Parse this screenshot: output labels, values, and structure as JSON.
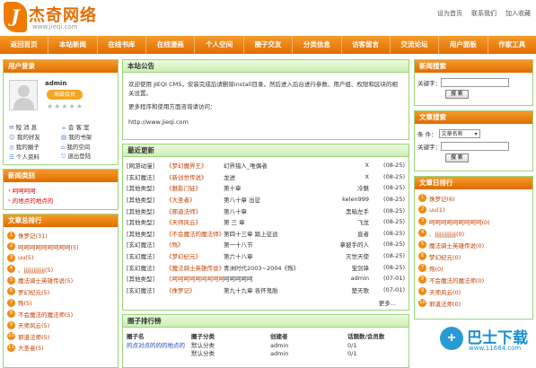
{
  "logo": {
    "mark": "J",
    "name": "杰奇网络",
    "url": "www.jieqi.com"
  },
  "toplinks": [
    "设为首页",
    "联系我们",
    "加入收藏"
  ],
  "nav": [
    "返回首页",
    "本站新闻",
    "在线书库",
    "在线漫画",
    "个人空间",
    "圈子交友",
    "分类信息",
    "访客留言",
    "交流论坛",
    "用户面板",
    "作家工具"
  ],
  "login": {
    "title": "用户登录",
    "user": "admin",
    "badge": "高级会员",
    "menu": [
      [
        "短 消 息",
        "会 客 室"
      ],
      [
        "我的好友",
        "我的书架"
      ],
      [
        "我的圈子",
        "我的空间"
      ],
      [
        "个人资料",
        "退出登陆"
      ]
    ]
  },
  "newsclass": {
    "title": "新闻类别",
    "items": [
      "呵呵呵呵",
      "的地点的地点的"
    ]
  },
  "ranking": {
    "title": "文章总排行",
    "items": [
      "侏罗记(31)",
      "呵呵呵呵呵呵呵呵呵(5)",
      "uu(5)",
      "、jjjjjjjjjjjjj(5)",
      "魔法骑士英雄传说(5)",
      "罗幻纪元(5)",
      "殇(5)",
      "不会魔法的魔法师(5)",
      "天师风云(5)",
      "邪道法师(5)",
      "大圣者(5)"
    ]
  },
  "notice": {
    "title": "本站公告",
    "text1": "欢迎使用 JIEQI CMS，安装完成后请删除install目录，然后进入后台进行参数、用户组、权限和区块的相关设置。",
    "text2": "更多程序和使用方面咨询请访问：",
    "text3": "http://www.jieqi.com"
  },
  "updates": {
    "title": "最近更新",
    "more": "更多...",
    "rows": [
      [
        "[网游动漫]",
        "《梦幻魔界王》",
        "幻界猎人_唯偶者",
        "X",
        "(08-25)"
      ],
      [
        "[玄幻魔法]",
        "《新创世传说》",
        "龙进",
        "X",
        "(08-25)"
      ],
      [
        "[其他类型]",
        "《魅影门徒》",
        "第十章",
        "冷魅",
        "(08-25)"
      ],
      [
        "[其他类型]",
        "《大圣者》",
        "第八十章 出征",
        "kelen999",
        "(08-25)"
      ],
      [
        "[其他类型]",
        "《邪道法师》",
        "第八十章",
        "黑暗左手",
        "(08-25)"
      ],
      [
        "[其他类型]",
        "《天师风云》",
        "第 三 章",
        "飞龙",
        "(08-25)"
      ],
      [
        "[其他类型]",
        "《不会魔法的魔法师》",
        "第四十三章 踏上征途",
        "直者",
        "(08-25)"
      ],
      [
        "[玄幻魔法]",
        "《殇》",
        "第一十八节",
        "拿披手的人",
        "(08-25)"
      ],
      [
        "[玄幻魔法]",
        "《梦幻纪元》",
        "第六十八章",
        "灭世天使",
        "(08-25)"
      ],
      [
        "[玄幻魔法]",
        "《魔法骑士英雄传说》",
        "青洲时代2003~2004《殇》",
        "宝剑锋",
        "(08-25)"
      ],
      [
        "[其他类型]",
        "《呵呵呵呵呵呵呵呵呵》",
        "呵呵呵呵呵",
        "admin",
        "(07-01)"
      ],
      [
        "[玄幻魔法]",
        "《侏罗记》",
        "第九十九章 各怀鬼胎",
        "楚天歌",
        "(07-01)"
      ]
    ]
  },
  "circles": {
    "title": "圈子排行榜",
    "headers": [
      "圈子名",
      "圈子分类",
      "创建者",
      "话题数/会员数"
    ],
    "rows": [
      [
        "的点对点的的的地点的",
        "默认分类",
        "admin",
        "0/1"
      ],
      [
        "",
        "默认分类",
        "admin",
        "0/1"
      ]
    ]
  },
  "newssearch": {
    "title": "新闻搜索",
    "label": "关键字：",
    "button": "搜 索"
  },
  "artsearch": {
    "title": "文章搜索",
    "cond_label": "条 件：",
    "select": "文章名称",
    "label": "关键字：",
    "button": "搜 索"
  },
  "dayrank": {
    "title": "文章日排行",
    "items": [
      "侏罗记(6)",
      "uu(1)",
      "呵呵呵呵呵呵呵呵呵(0)",
      "、jjjjjjjjjjjjj(0)",
      "魔法骑士英雄传说(0)",
      "梦幻纪元(0)",
      "殇(0)",
      "不会魔法的魔法师(0)",
      "天师风云(0)",
      "邪道法师(0)"
    ]
  },
  "watermark": {
    "text": "巴士下载",
    "sub": "www.11684.com"
  }
}
